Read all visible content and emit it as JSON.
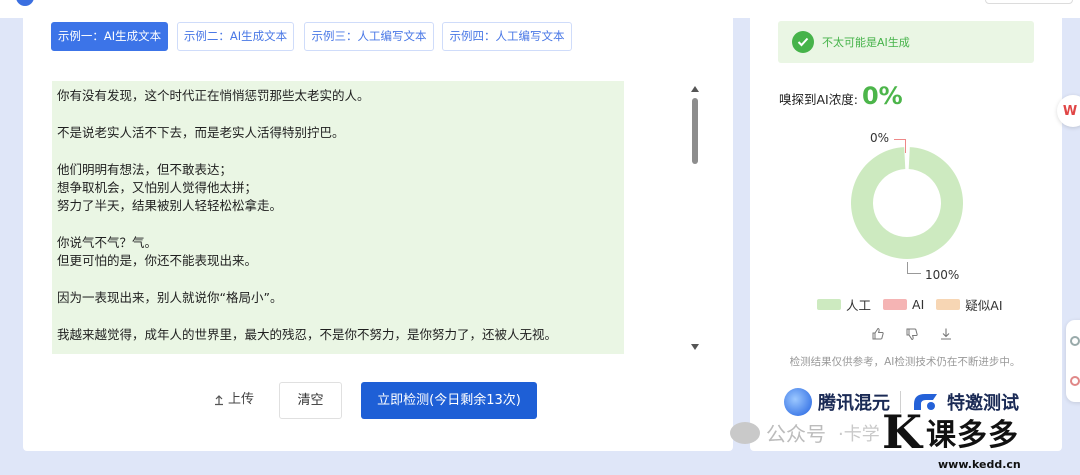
{
  "tabs": [
    {
      "label": "示例一：AI生成文本",
      "active": true
    },
    {
      "label": "示例二：AI生成文本",
      "active": false
    },
    {
      "label": "示例三：人工编写文本",
      "active": false
    },
    {
      "label": "示例四：人工编写文本",
      "active": false
    }
  ],
  "text_lines": [
    "你有没有发现，这个时代正在悄悄惩罚那些太老实的人。",
    "",
    "不是说老实人活不下去，而是老实人活得特别拧巴。",
    "",
    "他们明明有想法，但不敢表达；",
    "想争取机会，又怕别人觉得他太拼；",
    "努力了半天，结果被别人轻轻松松拿走。",
    "",
    "你说气不气？气。",
    "但更可怕的是，你还不能表现出来。",
    "",
    "因为一表现出来，别人就说你“格局小”。",
    "",
    "我越来越觉得，成年人的世界里，最大的残忍，不是你不努力，是你努力了，还被人无视。"
  ],
  "actions": {
    "upload_label": "上传",
    "clear_label": "清空",
    "detect_label": "立即检测(今日剩余13次)"
  },
  "result": {
    "verdict": "不太可能是AI生成",
    "concentration_label": "嗅探到AI浓度:",
    "concentration_value": "0%"
  },
  "chart_data": {
    "type": "pie",
    "style": "donut",
    "categories": [
      "人工",
      "AI",
      "疑似AI"
    ],
    "values": [
      100,
      0,
      0
    ],
    "data_labels": [
      "100%",
      "0%"
    ],
    "colors": [
      "#cdeac0",
      "#f5b4b4",
      "#f7d6b4"
    ],
    "legend_position": "bottom"
  },
  "legend": [
    {
      "label": "人工",
      "color": "#cdeac0"
    },
    {
      "label": "AI",
      "color": "#f5b4b4"
    },
    {
      "label": "疑似AI",
      "color": "#f7d6b4"
    }
  ],
  "feedback_icons": [
    "thumbs-up-icon",
    "thumbs-down-icon",
    "download-icon"
  ],
  "disclaimer": "检测结果仅供参考，AI检测技术仍在不断进步中。",
  "brand": {
    "name": "腾讯混元",
    "tag": "特邀测试"
  },
  "side": {
    "w_label": "W"
  },
  "watermark": {
    "wechat": "公众号",
    "wechat_suffix": "·卡学",
    "kedd_name": "课多多",
    "kedd_url": "www.kedd.cn"
  },
  "colors": {
    "accent": "#3c74e8",
    "detect_button": "#1e5fd6",
    "success": "#46b34a",
    "text_bg": "#eaf6e4"
  }
}
